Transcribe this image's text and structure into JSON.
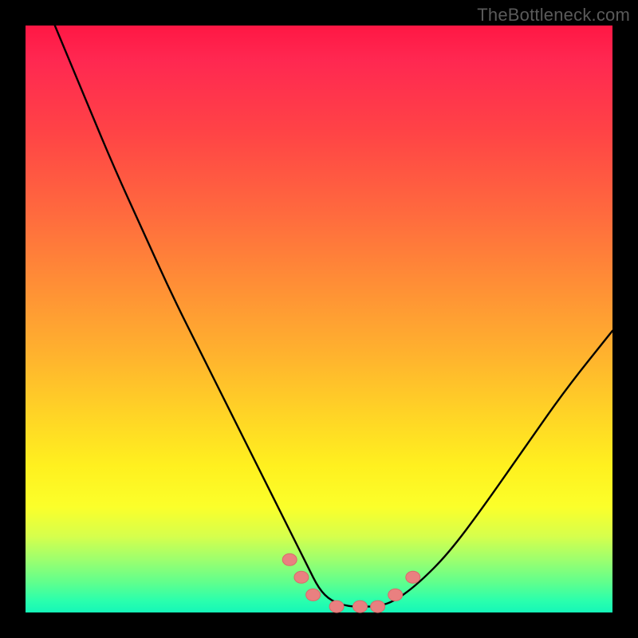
{
  "watermark": "TheBottleneck.com",
  "colors": {
    "frame": "#000000",
    "curve_stroke": "#000000",
    "marker_fill": "#e98080",
    "marker_stroke": "#d86a6a"
  },
  "chart_data": {
    "type": "line",
    "title": "",
    "xlabel": "",
    "ylabel": "",
    "xlim": [
      0,
      100
    ],
    "ylim": [
      0,
      100
    ],
    "series": [
      {
        "name": "bottleneck-curve",
        "x": [
          5,
          10,
          15,
          20,
          25,
          30,
          35,
          40,
          45,
          48,
          50,
          52,
          55,
          58,
          60,
          63,
          67,
          72,
          78,
          85,
          92,
          100
        ],
        "values": [
          100,
          88,
          76,
          65,
          54,
          44,
          34,
          24,
          14,
          8,
          4,
          2,
          1,
          1,
          1,
          2,
          5,
          10,
          18,
          28,
          38,
          48
        ]
      }
    ],
    "markers": {
      "name": "highlight-points",
      "x": [
        45,
        47,
        49,
        53,
        57,
        60,
        63,
        66
      ],
      "values": [
        9,
        6,
        3,
        1,
        1,
        1,
        3,
        6
      ]
    },
    "gradient_stops": [
      {
        "pos": 0,
        "color": "#ff1744"
      },
      {
        "pos": 18,
        "color": "#ff4346"
      },
      {
        "pos": 44,
        "color": "#ff8e36"
      },
      {
        "pos": 66,
        "color": "#ffd326"
      },
      {
        "pos": 82,
        "color": "#fbff2a"
      },
      {
        "pos": 95,
        "color": "#5eff8e"
      },
      {
        "pos": 100,
        "color": "#15f7b8"
      }
    ]
  }
}
